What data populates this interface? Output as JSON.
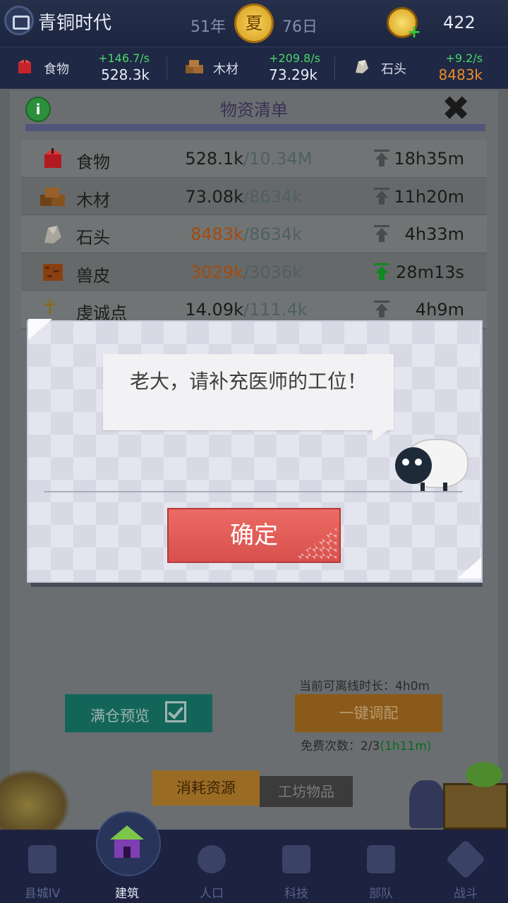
{
  "header": {
    "era": "青铜时代",
    "year": "51年",
    "season": "夏",
    "day": "76日",
    "gems": "422"
  },
  "resources": [
    {
      "name": "食物",
      "rate": "+146.7/s",
      "value": "528.3k",
      "value_color": "#e7ecf7"
    },
    {
      "name": "木材",
      "rate": "+209.8/s",
      "value": "73.29k",
      "value_color": "#e7ecf7"
    },
    {
      "name": "石头",
      "rate": "+9.2/s",
      "value": "8483k",
      "value_color": "#f08a2a"
    }
  ],
  "panel": {
    "title": "物资清单",
    "rows": [
      {
        "name": "食物",
        "current": "528.1k",
        "max": "/10.34M",
        "time": "18h35m",
        "arrow": "gray"
      },
      {
        "name": "木材",
        "current": "73.08k",
        "max": "/8634k",
        "time": "11h20m",
        "arrow": "gray"
      },
      {
        "name": "石头",
        "current": "8483k",
        "max": "/8634k",
        "time": "4h33m",
        "arrow": "gray"
      },
      {
        "name": "兽皮",
        "current": "3029k",
        "max": "/3036k",
        "time": "28m13s",
        "arrow": "green"
      },
      {
        "name": "虔诚点",
        "current": "14.09k",
        "max": "/111.4k",
        "time": "4h9m",
        "arrow": "gray"
      }
    ],
    "offline_label": "当前可离线时长：4h0m",
    "preview_button": "满仓预览",
    "assign_button": "一键调配",
    "free_count_prefix": "免费次数：2/3",
    "free_count_timer": "(1h11m)",
    "tab_consume": "消耗资源",
    "tab_items": "工坊物品"
  },
  "dialog": {
    "message": "老大，请补充医师的工位！",
    "confirm": "确定"
  },
  "nav": [
    {
      "label": "县城IV",
      "active": false
    },
    {
      "label": "建筑",
      "active": true
    },
    {
      "label": "人口",
      "active": false
    },
    {
      "label": "科技",
      "active": false
    },
    {
      "label": "部队",
      "active": false
    },
    {
      "label": "战斗",
      "active": false
    }
  ],
  "colors": {
    "rate_green": "#48d86b",
    "warning_orange": "#a34b0b",
    "confirm_red": "#e05a56"
  }
}
